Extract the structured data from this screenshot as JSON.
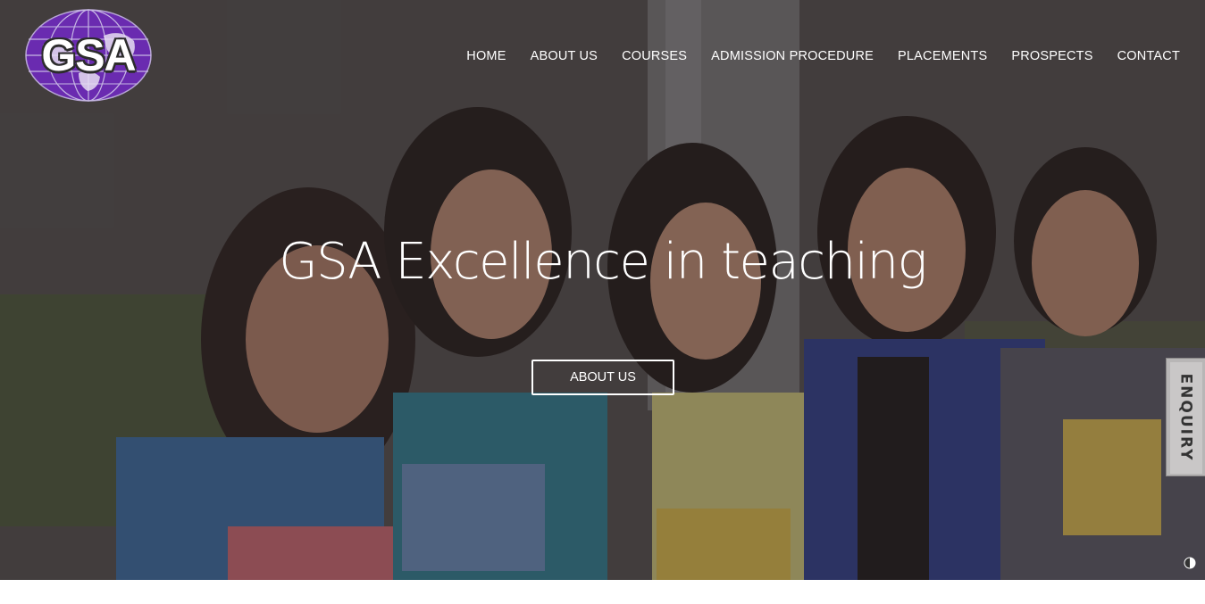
{
  "brand": {
    "logo_text": "GSA"
  },
  "nav": {
    "items": [
      "HOME",
      "ABOUT US",
      "COURSES",
      "ADMISSION PROCEDURE",
      "PLACEMENTS",
      "PROSPECTS",
      "CONTACT"
    ]
  },
  "hero": {
    "headline": "GSA Excellence in teaching",
    "cta_label": "ABOUT US",
    "background_image": "group-of-students-photo"
  },
  "enquiry": {
    "label": "ENQUIRY"
  },
  "colors": {
    "logo_purple": "#6a2bb0",
    "text": "#ffffff",
    "enquiry_bg": "#c9c7c7"
  },
  "icons": {
    "corner": "half-circle-icon"
  }
}
